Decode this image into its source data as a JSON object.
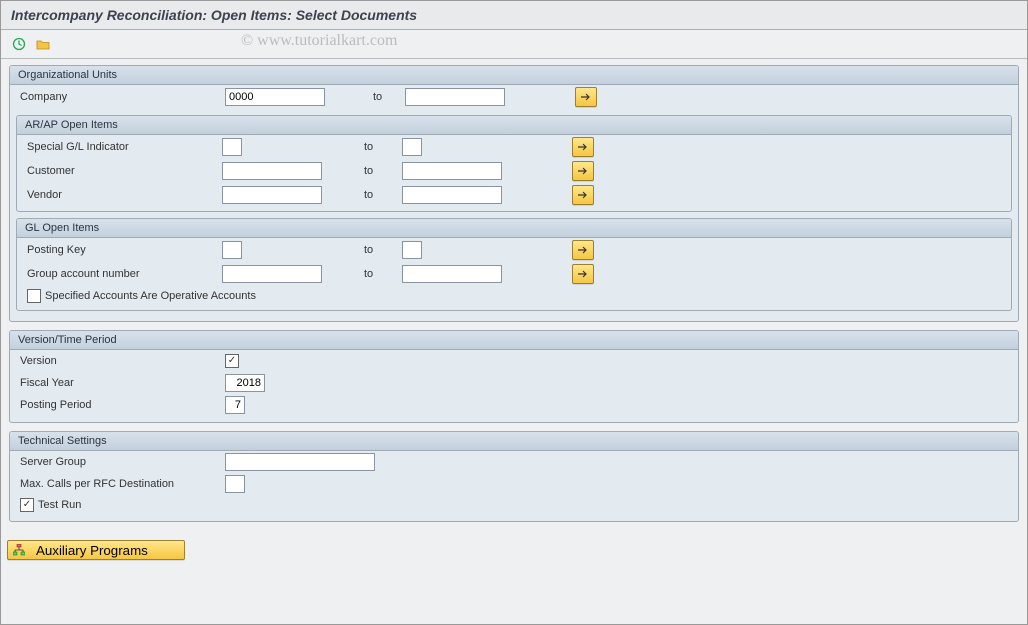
{
  "title": "Intercompany Reconciliation: Open Items: Select Documents",
  "watermark": "© www.tutorialkart.com",
  "org": {
    "header": "Organizational Units",
    "company_label": "Company",
    "company_from": "0000",
    "to": "to",
    "arap": {
      "header": "AR/AP Open Items",
      "special_gl_label": "Special G/L Indicator",
      "customer_label": "Customer",
      "vendor_label": "Vendor"
    },
    "gl": {
      "header": "GL Open Items",
      "posting_key_label": "Posting Key",
      "group_acct_label": "Group account number",
      "specified_label": "Specified Accounts Are Operative Accounts"
    }
  },
  "version": {
    "header": "Version/Time Period",
    "version_label": "Version",
    "version_checked": true,
    "fiscal_year_label": "Fiscal Year",
    "fiscal_year": "2018",
    "posting_period_label": "Posting Period",
    "posting_period": "7"
  },
  "tech": {
    "header": "Technical Settings",
    "server_group_label": "Server Group",
    "max_calls_label": "Max. Calls per RFC Destination",
    "test_run_label": "Test Run",
    "test_run_checked": true
  },
  "aux_button": "Auxiliary Programs"
}
